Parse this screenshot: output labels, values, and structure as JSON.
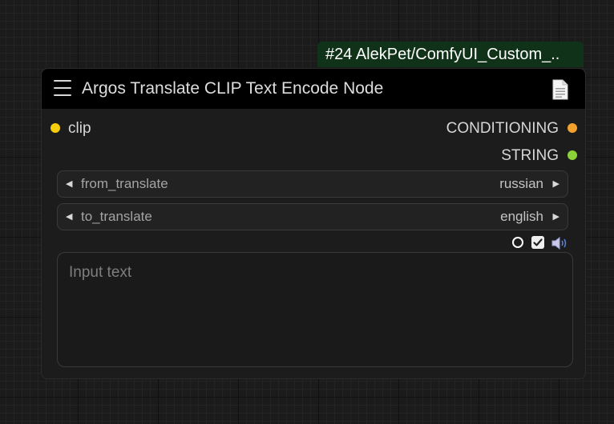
{
  "badge": {
    "text": "#24 AlekPet/ComfyUI_Custom_.."
  },
  "node": {
    "title": "Argos Translate CLIP Text Encode Node",
    "icons": {
      "menu": "hamburger-menu-icon",
      "doc": "document-icon"
    },
    "inputs": [
      {
        "label": "clip",
        "color": "#f5cd0b"
      }
    ],
    "outputs": [
      {
        "label": "CONDITIONING",
        "color": "#f2a12f"
      },
      {
        "label": "STRING",
        "color": "#8bd13a"
      }
    ],
    "widgets": {
      "from_translate": {
        "name": "from_translate",
        "value": "russian"
      },
      "to_translate": {
        "name": "to_translate",
        "value": "english"
      }
    },
    "text_input": {
      "value": "",
      "placeholder": "Input text"
    },
    "toolbar": {
      "icons": [
        "circle-toggle-icon",
        "checkbox-icon",
        "speaker-icon"
      ],
      "checkbox_checked": true
    }
  }
}
